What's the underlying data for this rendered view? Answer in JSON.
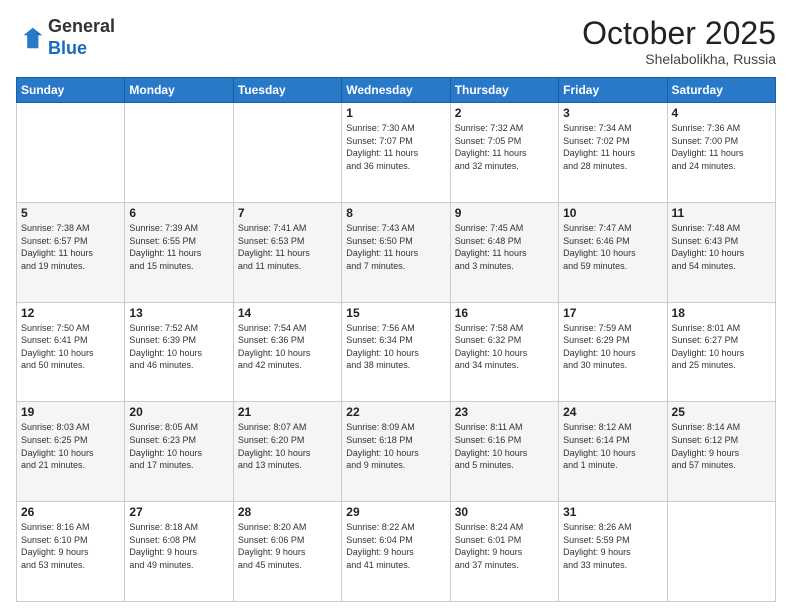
{
  "logo": {
    "general": "General",
    "blue": "Blue"
  },
  "title": "October 2025",
  "location": "Shelabolikha, Russia",
  "weekdays": [
    "Sunday",
    "Monday",
    "Tuesday",
    "Wednesday",
    "Thursday",
    "Friday",
    "Saturday"
  ],
  "weeks": [
    [
      {
        "day": "",
        "info": ""
      },
      {
        "day": "",
        "info": ""
      },
      {
        "day": "",
        "info": ""
      },
      {
        "day": "1",
        "info": "Sunrise: 7:30 AM\nSunset: 7:07 PM\nDaylight: 11 hours\nand 36 minutes."
      },
      {
        "day": "2",
        "info": "Sunrise: 7:32 AM\nSunset: 7:05 PM\nDaylight: 11 hours\nand 32 minutes."
      },
      {
        "day": "3",
        "info": "Sunrise: 7:34 AM\nSunset: 7:02 PM\nDaylight: 11 hours\nand 28 minutes."
      },
      {
        "day": "4",
        "info": "Sunrise: 7:36 AM\nSunset: 7:00 PM\nDaylight: 11 hours\nand 24 minutes."
      }
    ],
    [
      {
        "day": "5",
        "info": "Sunrise: 7:38 AM\nSunset: 6:57 PM\nDaylight: 11 hours\nand 19 minutes."
      },
      {
        "day": "6",
        "info": "Sunrise: 7:39 AM\nSunset: 6:55 PM\nDaylight: 11 hours\nand 15 minutes."
      },
      {
        "day": "7",
        "info": "Sunrise: 7:41 AM\nSunset: 6:53 PM\nDaylight: 11 hours\nand 11 minutes."
      },
      {
        "day": "8",
        "info": "Sunrise: 7:43 AM\nSunset: 6:50 PM\nDaylight: 11 hours\nand 7 minutes."
      },
      {
        "day": "9",
        "info": "Sunrise: 7:45 AM\nSunset: 6:48 PM\nDaylight: 11 hours\nand 3 minutes."
      },
      {
        "day": "10",
        "info": "Sunrise: 7:47 AM\nSunset: 6:46 PM\nDaylight: 10 hours\nand 59 minutes."
      },
      {
        "day": "11",
        "info": "Sunrise: 7:48 AM\nSunset: 6:43 PM\nDaylight: 10 hours\nand 54 minutes."
      }
    ],
    [
      {
        "day": "12",
        "info": "Sunrise: 7:50 AM\nSunset: 6:41 PM\nDaylight: 10 hours\nand 50 minutes."
      },
      {
        "day": "13",
        "info": "Sunrise: 7:52 AM\nSunset: 6:39 PM\nDaylight: 10 hours\nand 46 minutes."
      },
      {
        "day": "14",
        "info": "Sunrise: 7:54 AM\nSunset: 6:36 PM\nDaylight: 10 hours\nand 42 minutes."
      },
      {
        "day": "15",
        "info": "Sunrise: 7:56 AM\nSunset: 6:34 PM\nDaylight: 10 hours\nand 38 minutes."
      },
      {
        "day": "16",
        "info": "Sunrise: 7:58 AM\nSunset: 6:32 PM\nDaylight: 10 hours\nand 34 minutes."
      },
      {
        "day": "17",
        "info": "Sunrise: 7:59 AM\nSunset: 6:29 PM\nDaylight: 10 hours\nand 30 minutes."
      },
      {
        "day": "18",
        "info": "Sunrise: 8:01 AM\nSunset: 6:27 PM\nDaylight: 10 hours\nand 25 minutes."
      }
    ],
    [
      {
        "day": "19",
        "info": "Sunrise: 8:03 AM\nSunset: 6:25 PM\nDaylight: 10 hours\nand 21 minutes."
      },
      {
        "day": "20",
        "info": "Sunrise: 8:05 AM\nSunset: 6:23 PM\nDaylight: 10 hours\nand 17 minutes."
      },
      {
        "day": "21",
        "info": "Sunrise: 8:07 AM\nSunset: 6:20 PM\nDaylight: 10 hours\nand 13 minutes."
      },
      {
        "day": "22",
        "info": "Sunrise: 8:09 AM\nSunset: 6:18 PM\nDaylight: 10 hours\nand 9 minutes."
      },
      {
        "day": "23",
        "info": "Sunrise: 8:11 AM\nSunset: 6:16 PM\nDaylight: 10 hours\nand 5 minutes."
      },
      {
        "day": "24",
        "info": "Sunrise: 8:12 AM\nSunset: 6:14 PM\nDaylight: 10 hours\nand 1 minute."
      },
      {
        "day": "25",
        "info": "Sunrise: 8:14 AM\nSunset: 6:12 PM\nDaylight: 9 hours\nand 57 minutes."
      }
    ],
    [
      {
        "day": "26",
        "info": "Sunrise: 8:16 AM\nSunset: 6:10 PM\nDaylight: 9 hours\nand 53 minutes."
      },
      {
        "day": "27",
        "info": "Sunrise: 8:18 AM\nSunset: 6:08 PM\nDaylight: 9 hours\nand 49 minutes."
      },
      {
        "day": "28",
        "info": "Sunrise: 8:20 AM\nSunset: 6:06 PM\nDaylight: 9 hours\nand 45 minutes."
      },
      {
        "day": "29",
        "info": "Sunrise: 8:22 AM\nSunset: 6:04 PM\nDaylight: 9 hours\nand 41 minutes."
      },
      {
        "day": "30",
        "info": "Sunrise: 8:24 AM\nSunset: 6:01 PM\nDaylight: 9 hours\nand 37 minutes."
      },
      {
        "day": "31",
        "info": "Sunrise: 8:26 AM\nSunset: 5:59 PM\nDaylight: 9 hours\nand 33 minutes."
      },
      {
        "day": "",
        "info": ""
      }
    ]
  ]
}
